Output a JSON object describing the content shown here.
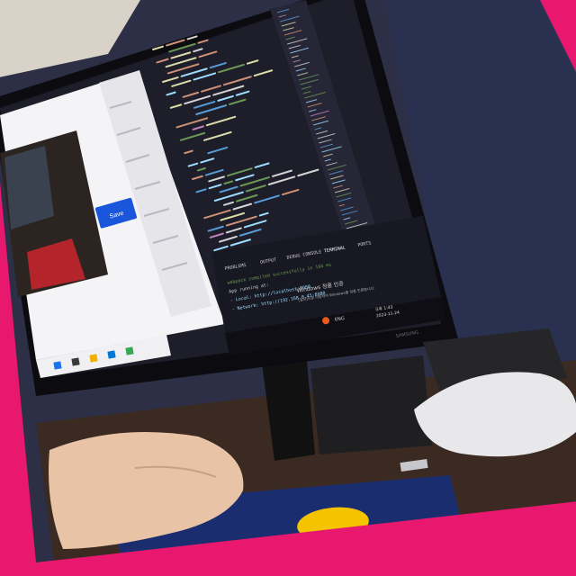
{
  "colors": {
    "frame": "#e8186f",
    "desk": "#3a2a22",
    "wall": "#2a3150",
    "editor_bg": "#1e1e2a",
    "keyword": "#569cd6",
    "string": "#ce9178",
    "function": "#dcdcaa",
    "variable": "#9cdcfe",
    "comment": "#6a9955",
    "browser_button": "#1a56db",
    "mousepad": "#1a2d6e",
    "mousepad_logo": "#f5c400"
  },
  "browser": {
    "button_label": "Save"
  },
  "editor": {
    "terminal_tabs": [
      "PROBLEMS",
      "OUTPUT",
      "DEBUG CONSOLE",
      "TERMINAL",
      "PORTS"
    ],
    "terminal_lines": [
      "webpack compiled successfully in 104 ms",
      "App running at:",
      "- Local:   http://localhost:8080",
      "- Network: http://192.168.0.45:8080"
    ]
  },
  "windows_notice": {
    "title": "Windows 정품 인증",
    "body": "[설정]으로 이동하여 Windows를 정품 인증합니다."
  },
  "taskbar": {
    "lang": "ENG",
    "time": "오후 1:43",
    "date": "2023-11-24"
  },
  "monitor": {
    "brand": "SAMSUNG"
  }
}
